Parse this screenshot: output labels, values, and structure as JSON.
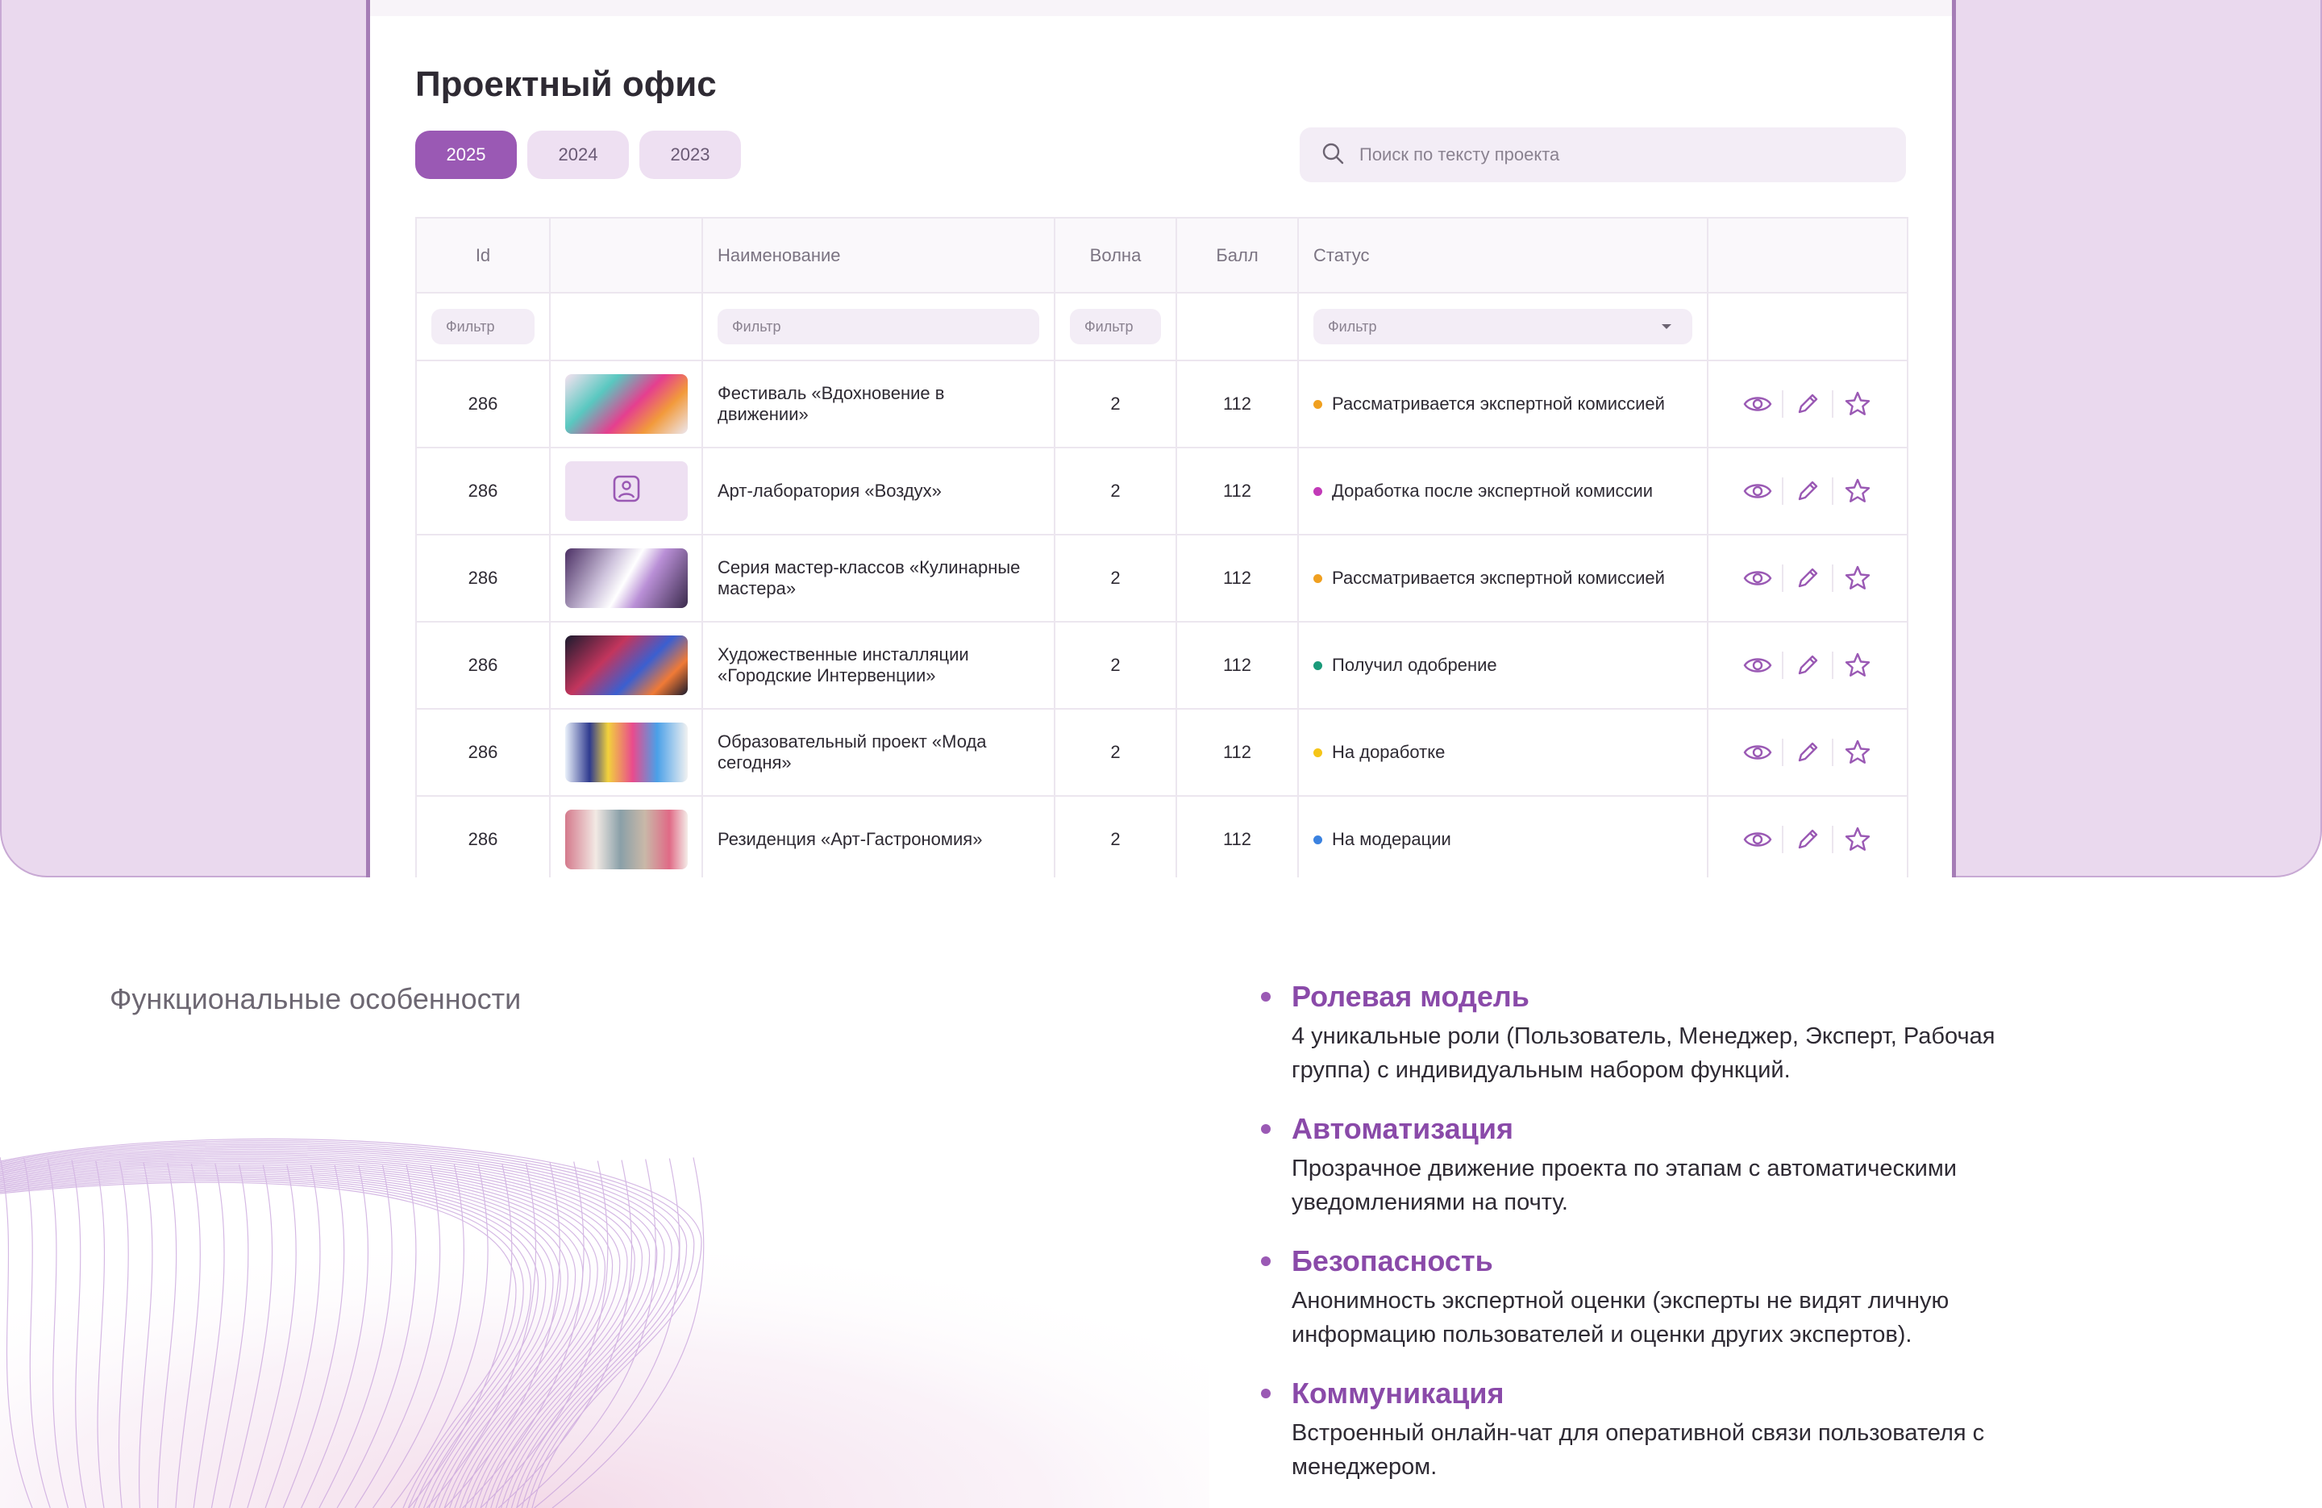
{
  "page": {
    "title": "Проектный офис",
    "year_tabs": [
      "2025",
      "2024",
      "2023"
    ],
    "active_year": "2025",
    "search_placeholder": "Поиск по тексту проекта"
  },
  "table": {
    "headers": {
      "id": "Id",
      "image": "",
      "name": "Наименование",
      "wave": "Волна",
      "score": "Балл",
      "status": "Статус",
      "actions": ""
    },
    "filter_placeholder": "Фильтр",
    "rows": [
      {
        "id": "286",
        "name": "Фестиваль «Вдохновение в движении»",
        "wave": "2",
        "score": "112",
        "status": "Рассматривается экспертной комиссией",
        "status_color": "#f0a020",
        "image": "photo"
      },
      {
        "id": "286",
        "name": "Арт-лаборатория «Воздух»",
        "wave": "2",
        "score": "112",
        "status": "Доработка после экспертной комиссии",
        "status_color": "#c23ab8",
        "image": "placeholder-image-icon"
      },
      {
        "id": "286",
        "name": "Серия мастер-классов «Кулинарные мастера»",
        "wave": "2",
        "score": "112",
        "status": "Рассматривается экспертной комиссией",
        "status_color": "#f0a020",
        "image": "photo"
      },
      {
        "id": "286",
        "name": "Художественные инсталляции «Городские Интервенции»",
        "wave": "2",
        "score": "112",
        "status": "Получил одобрение",
        "status_color": "#1a9a7a",
        "image": "photo"
      },
      {
        "id": "286",
        "name": "Образовательный проект «Мода сегодня»",
        "wave": "2",
        "score": "112",
        "status": "На доработке",
        "status_color": "#f5c518",
        "image": "photo"
      },
      {
        "id": "286",
        "name": "Резиденция «Арт-Гастрономия»",
        "wave": "2",
        "score": "112",
        "status": "На модерации",
        "status_color": "#3b82e0",
        "image": "photo"
      }
    ],
    "row_actions": [
      "eye-icon",
      "pencil-icon",
      "star-icon"
    ]
  },
  "features": {
    "section_title": "Функциональные особенности",
    "items": [
      {
        "title": "Ролевая модель",
        "text": "4 уникальные роли (Пользователь, Менеджер, Эксперт, Рабочая группа) с индивидуальным набором функций."
      },
      {
        "title": "Автоматизация",
        "text": "Прозрачное движение проекта по этапам с автоматическими уведомлениями на почту."
      },
      {
        "title": "Безопасность",
        "text": "Анонимность экспертной оценки (эксперты не видят личную информацию пользователей и оценки других экспертов)."
      },
      {
        "title": "Коммуникация",
        "text": "Встроенный онлайн-чат для оперативной связи пользователя с менеджером."
      }
    ]
  },
  "colors": {
    "accent": "#9a59b4",
    "background_band": "#ead9ee",
    "frame_border": "#a57db6",
    "feature_title": "#8a4aa9"
  }
}
